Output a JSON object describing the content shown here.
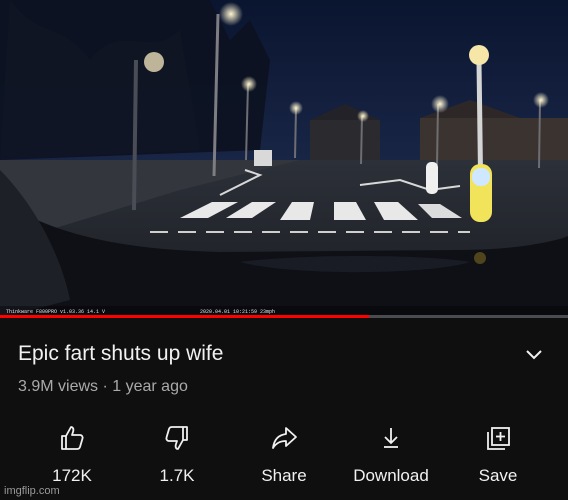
{
  "video": {
    "overlay_text_left": "Thinkware F800PRO  v1.03.36  14.1 V",
    "overlay_text_right": "2020.04.01 10:21:59  23mph",
    "progress": 0.65,
    "accent_color": "#ff0000"
  },
  "details": {
    "title": "Epic fart shuts up wife",
    "views": "3.9M views",
    "separator": "·",
    "age": "1 year ago"
  },
  "actions": [
    {
      "icon": "thumbs-up-icon",
      "label": "172K"
    },
    {
      "icon": "thumbs-down-icon",
      "label": "1.7K"
    },
    {
      "icon": "share-icon",
      "label": "Share"
    },
    {
      "icon": "download-icon",
      "label": "Download"
    },
    {
      "icon": "save-playlist-icon",
      "label": "Save"
    }
  ],
  "watermark": "imgflip.com"
}
